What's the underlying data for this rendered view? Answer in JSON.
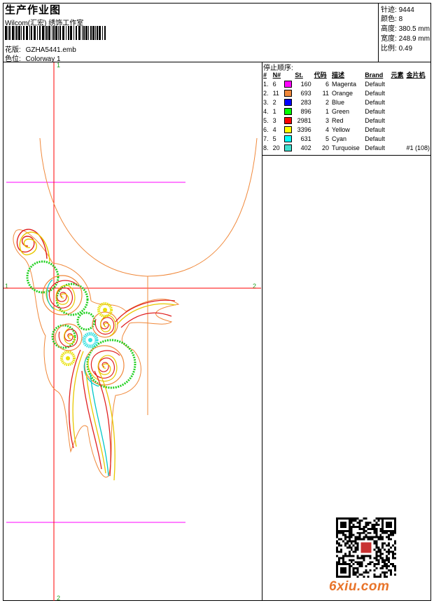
{
  "header": {
    "title": "生产作业图",
    "subtitle": "Wilcom(汇宏) 绣饰工作室",
    "design_label": "花版:",
    "design_value": "GZHA5441.emb",
    "colorway_label": "色位:",
    "colorway_value": "Colorway 1"
  },
  "stats": [
    {
      "label": "针迹:",
      "value": "9444"
    },
    {
      "label": "颜色:",
      "value": "8"
    },
    {
      "label": "高度:",
      "value": "380.5 mm"
    },
    {
      "label": "宽度:",
      "value": "248.9 mm"
    },
    {
      "label": "比例:",
      "value": "0.49"
    }
  ],
  "stop_sequence": {
    "title": "停止顺序:",
    "columns": [
      "#",
      "N#",
      "St.",
      "代码",
      "描述",
      "Brand",
      "元素",
      "金片机"
    ],
    "rows": [
      {
        "idx": "1.",
        "n": "6",
        "color": "#ff00ff",
        "st": "160",
        "code": "6",
        "desc": "Magenta",
        "brand": "Default",
        "extra": ""
      },
      {
        "idx": "2.",
        "n": "11",
        "color": "#f0883a",
        "st": "693",
        "code": "11",
        "desc": "Orange",
        "brand": "Default",
        "extra": ""
      },
      {
        "idx": "3.",
        "n": "2",
        "color": "#0000ff",
        "st": "283",
        "code": "2",
        "desc": "Blue",
        "brand": "Default",
        "extra": ""
      },
      {
        "idx": "4.",
        "n": "1",
        "color": "#00ff00",
        "st": "896",
        "code": "1",
        "desc": "Green",
        "brand": "Default",
        "extra": ""
      },
      {
        "idx": "5.",
        "n": "3",
        "color": "#ff0000",
        "st": "2981",
        "code": "3",
        "desc": "Red",
        "brand": "Default",
        "extra": ""
      },
      {
        "idx": "6.",
        "n": "4",
        "color": "#ffff00",
        "st": "3396",
        "code": "4",
        "desc": "Yellow",
        "brand": "Default",
        "extra": ""
      },
      {
        "idx": "7.",
        "n": "5",
        "color": "#00ffff",
        "st": "631",
        "code": "5",
        "desc": "Cyan",
        "brand": "Default",
        "extra": ""
      },
      {
        "idx": "8.",
        "n": "20",
        "color": "#40e0d0",
        "st": "402",
        "code": "20",
        "desc": "Turquoise",
        "brand": "Default",
        "extra": "#1 (108)"
      }
    ]
  },
  "axis_markers": {
    "top": "1",
    "bottom": "2",
    "left": "1",
    "right": "2"
  },
  "watermark": "6xiu.com"
}
